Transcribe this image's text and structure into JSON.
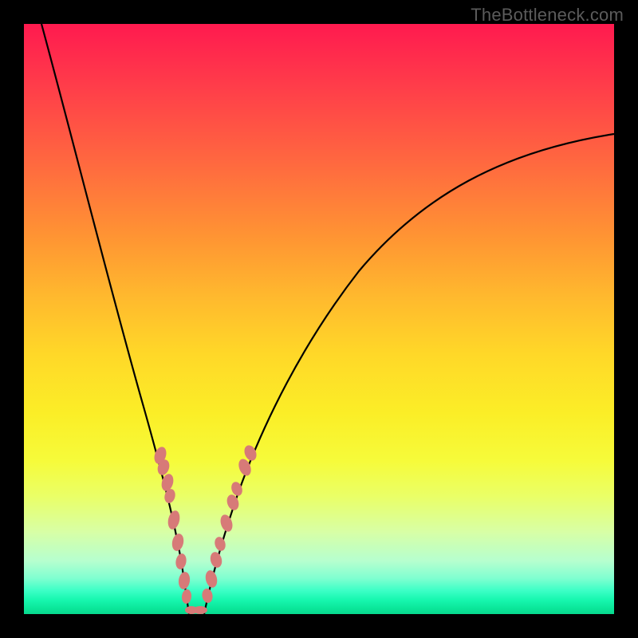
{
  "watermark": "TheBottleneck.com",
  "chart_data": {
    "type": "line",
    "title": "",
    "xlabel": "",
    "ylabel": "",
    "xlim": [
      0,
      100
    ],
    "ylim": [
      0,
      100
    ],
    "background_gradient": {
      "top_color": "#ff1a4f",
      "bottom_color": "#07d98e",
      "meaning": "bottleneck severity (red=high, green=low)"
    },
    "series": [
      {
        "name": "left-curve",
        "x": [
          3,
          6,
          9,
          12,
          15,
          18,
          21,
          23,
          25,
          26.5,
          27.5
        ],
        "values": [
          100,
          84,
          70,
          57,
          45,
          34,
          24,
          16,
          9,
          4,
          0
        ]
      },
      {
        "name": "right-curve",
        "x": [
          30,
          32,
          34,
          37,
          40,
          45,
          52,
          60,
          70,
          82,
          95,
          100
        ],
        "values": [
          0,
          6,
          12,
          20,
          28,
          38,
          49,
          58,
          66,
          73,
          79,
          81
        ]
      }
    ],
    "annotations": {
      "bead_cluster_left": {
        "description": "salmon oval markers along lower left curve",
        "approx_x_range": [
          21,
          27
        ],
        "approx_y_range": [
          4,
          28
        ]
      },
      "bead_cluster_right": {
        "description": "salmon oval markers along lower right curve",
        "approx_x_range": [
          30,
          36
        ],
        "approx_y_range": [
          2,
          28
        ]
      },
      "valley_beads": {
        "description": "short horizontal salmon line at curve minimum",
        "approx_x_range": [
          27,
          30
        ],
        "approx_y": 0.5
      }
    }
  }
}
